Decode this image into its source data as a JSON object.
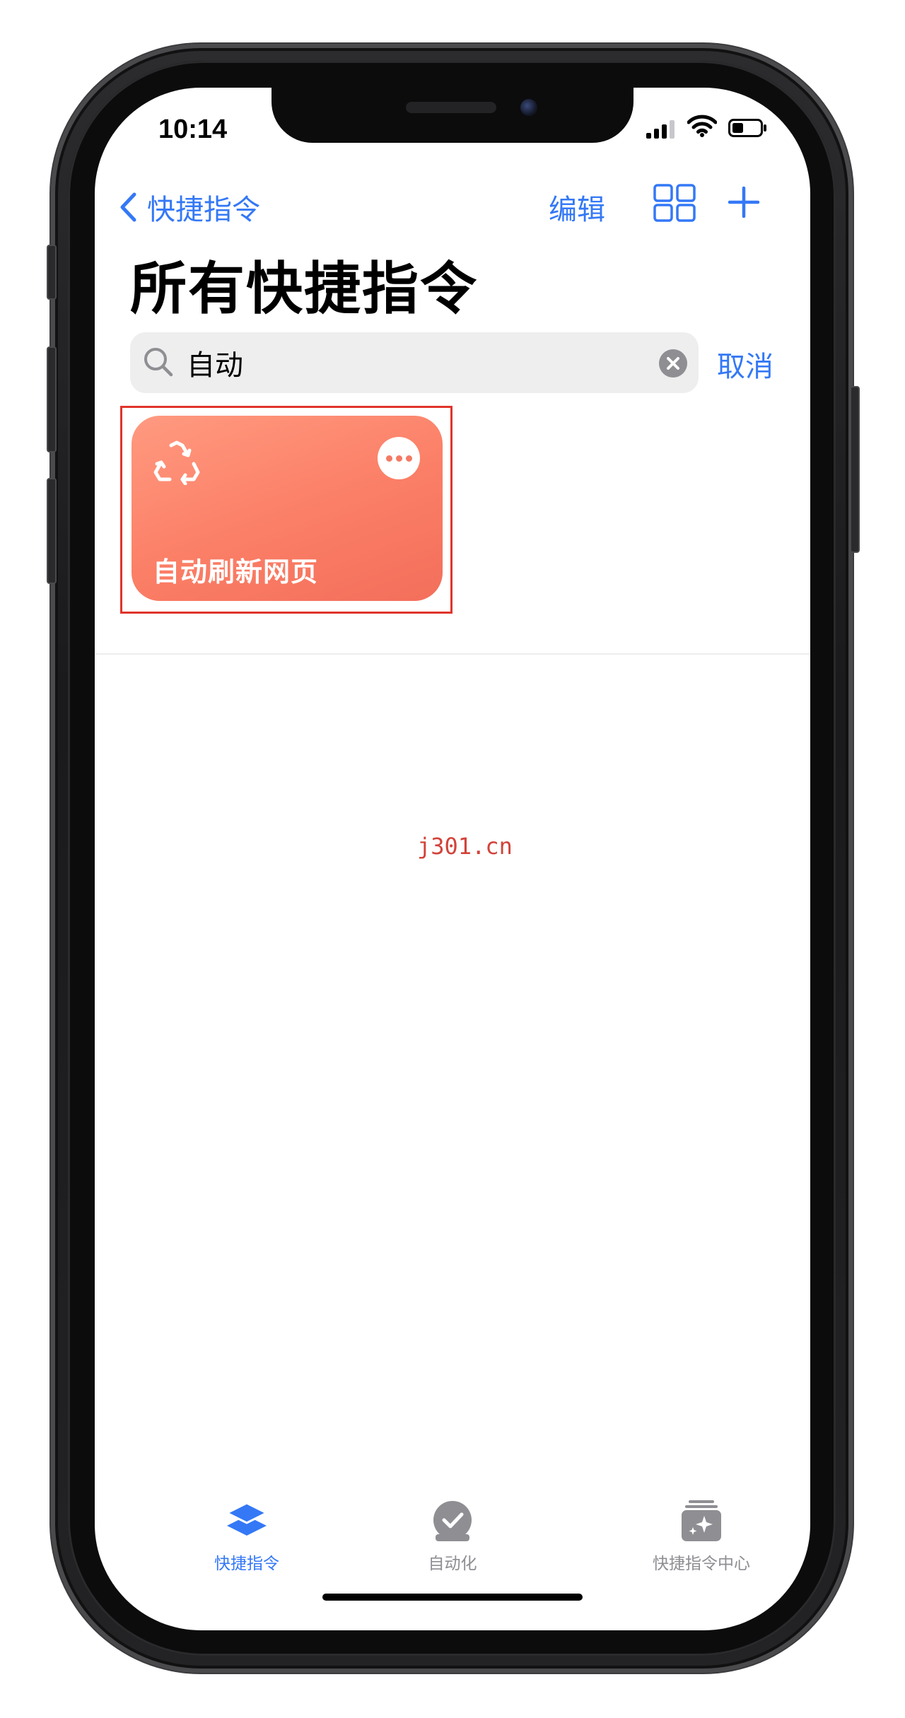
{
  "status_bar": {
    "time": "10:14"
  },
  "nav": {
    "back_label": "快捷指令",
    "edit_label": "编辑"
  },
  "page": {
    "title": "所有快捷指令"
  },
  "search": {
    "value": "自动",
    "cancel_label": "取消"
  },
  "shortcuts": [
    {
      "title": "自动刷新网页",
      "icon": "recycle-icon",
      "color": "#f97d66"
    }
  ],
  "watermark": "j301.cn",
  "tab_bar": {
    "items": [
      {
        "label": "快捷指令",
        "icon": "layers-icon",
        "active": true
      },
      {
        "label": "自动化",
        "icon": "automation-check-icon",
        "active": false
      },
      {
        "label": "快捷指令中心",
        "icon": "gallery-sparkle-icon",
        "active": false
      }
    ]
  },
  "colors": {
    "accent": "#3478f6",
    "inactive": "#8e8e93",
    "highlight": "#e0352b"
  }
}
